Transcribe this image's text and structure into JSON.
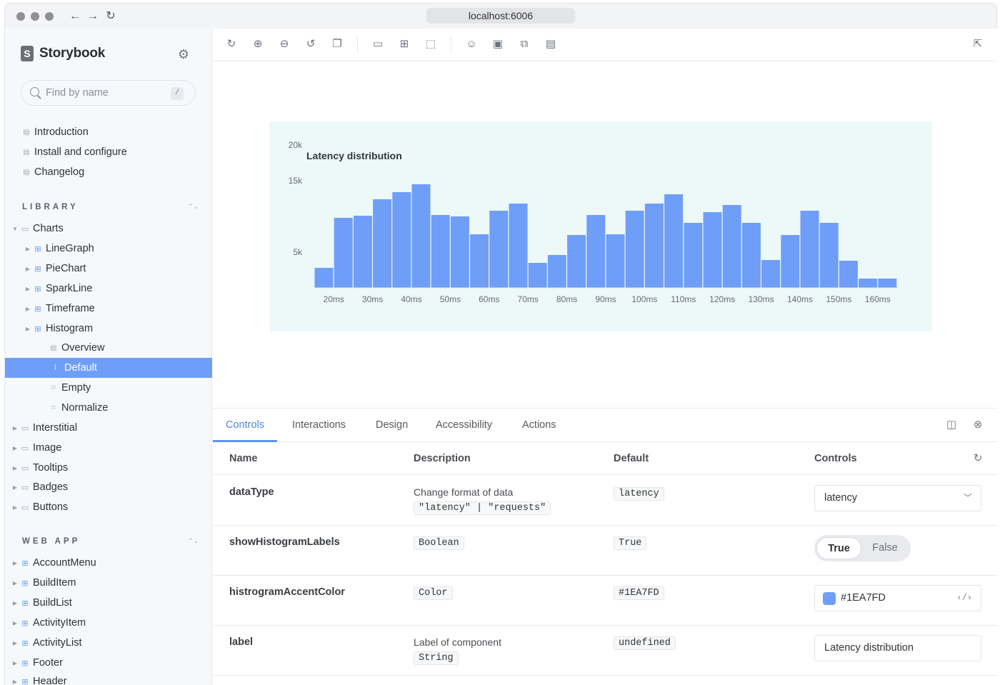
{
  "browser": {
    "url": "localhost:6006"
  },
  "brand": {
    "name": "Storybook",
    "logo_letter": "S"
  },
  "search": {
    "placeholder": "Find by name",
    "shortcut": "/"
  },
  "docs": [
    "Introduction",
    "Install and configure",
    "Changelog"
  ],
  "library": {
    "title": "LIBRARY",
    "root": "Charts",
    "components": [
      "LineGraph",
      "PieChart",
      "SparkLine",
      "Timeframe",
      "Histogram"
    ],
    "histogram_children": [
      "Overview",
      "Default",
      "Empty",
      "Normalize"
    ],
    "active_story": "Default",
    "other_folders": [
      "Interstitial",
      "Image",
      "Tooltips",
      "Badges",
      "Buttons"
    ]
  },
  "webapp": {
    "title": "WEB APP",
    "components": [
      "AccountMenu",
      "BuildItem",
      "BuildList",
      "ActivityItem",
      "ActivityList",
      "Footer",
      "Header"
    ]
  },
  "toolbar": {
    "icons": [
      "reload-icon",
      "zoom-in-icon",
      "zoom-out-icon",
      "zoom-reset-icon",
      "background-icon",
      "viewport-icon",
      "grid-icon",
      "outline-icon",
      "accessibility-icon",
      "image-icon",
      "measure-icon",
      "comment-icon"
    ],
    "open_new_tab_icon": "external-link-icon"
  },
  "chart_data": {
    "type": "bar",
    "title": "Latency distribution",
    "xlabel": "",
    "ylabel": "",
    "accent_color": "#6E9EF8",
    "y_ticks": [
      "5k",
      "15k",
      "20k"
    ],
    "x_tick_labels": [
      "20ms",
      "30ms",
      "40ms",
      "50ms",
      "60ms",
      "70ms",
      "80ms",
      "90ms",
      "100ms",
      "110ms",
      "120ms",
      "130ms",
      "140ms",
      "150ms",
      "160ms"
    ],
    "values": [
      2800,
      9800,
      10100,
      12400,
      13400,
      14500,
      10200,
      10000,
      7500,
      10800,
      11800,
      3500,
      4600,
      7400,
      10200,
      7500,
      10800,
      11800,
      13100,
      9100,
      10600,
      11600,
      9100,
      3900,
      7400,
      10800,
      9100,
      3800,
      1300,
      1300
    ],
    "ylim": [
      0,
      20000
    ]
  },
  "panel": {
    "tabs": [
      "Controls",
      "Interactions",
      "Design",
      "Accessibility",
      "Actions"
    ],
    "active_tab": "Controls",
    "headers": {
      "name": "Name",
      "description": "Description",
      "default": "Default",
      "controls": "Controls"
    },
    "rows": [
      {
        "name": "dataType",
        "description": "Change format of data",
        "type": "\"latency\" | \"requests\"",
        "default": "latency",
        "control": "latency"
      },
      {
        "name": "showHistogramLabels",
        "type": "Boolean",
        "default": "True",
        "control_on": "True",
        "control_off": "False"
      },
      {
        "name": "histrogramAccentColor",
        "type": "Color",
        "default": "#1EA7FD",
        "control": "#1EA7FD"
      },
      {
        "name": "label",
        "description": "Label of component",
        "type": "String",
        "default": "undefined",
        "control": "Latency distribution"
      }
    ]
  }
}
